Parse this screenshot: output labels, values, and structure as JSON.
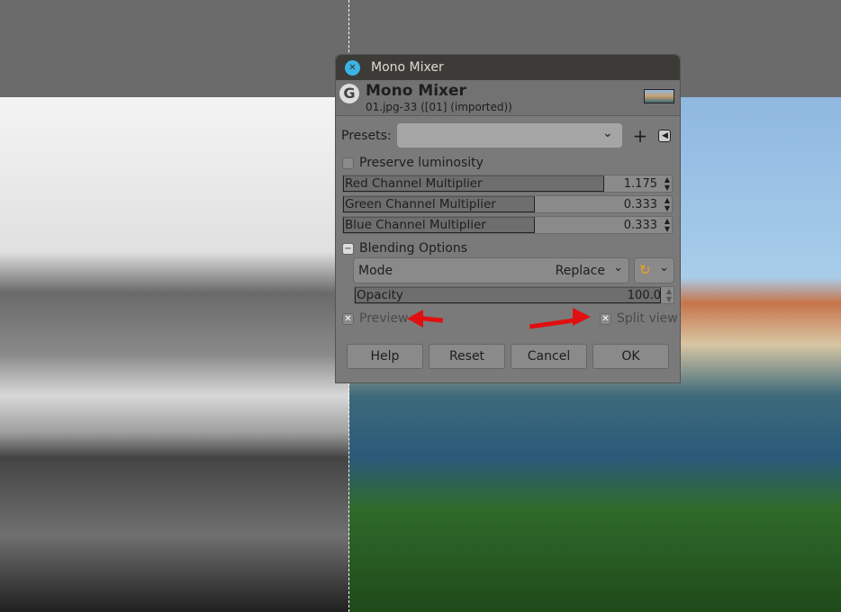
{
  "dialog": {
    "window_title": "Mono Mixer",
    "header_title": "Mono Mixer",
    "header_subtitle": "01.jpg-33 ([01] (imported))",
    "presets_label": "Presets:",
    "presets_value": "",
    "preserve_luminosity": {
      "label": "Preserve luminosity",
      "checked": false
    },
    "sliders": [
      {
        "label": "Red Channel Multiplier",
        "value": "1.175",
        "fraction": 0.794
      },
      {
        "label": "Green Channel Multiplier",
        "value": "0.333",
        "fraction": 0.583
      },
      {
        "label": "Blue Channel Multiplier",
        "value": "0.333",
        "fraction": 0.583
      }
    ],
    "blending": {
      "label": "Blending Options",
      "mode_label": "Mode",
      "mode_value": "Replace",
      "opacity_label": "Opacity",
      "opacity_value": "100.0",
      "opacity_fraction": 1.0
    },
    "preview": {
      "label": "Preview",
      "checked": true
    },
    "split_view": {
      "label": "Split view",
      "checked": true
    },
    "buttons": {
      "help": "Help",
      "reset": "Reset",
      "cancel": "Cancel",
      "ok": "OK"
    }
  },
  "colors": {
    "arrow": "#e01010",
    "titlebar": "#3c3b37"
  }
}
